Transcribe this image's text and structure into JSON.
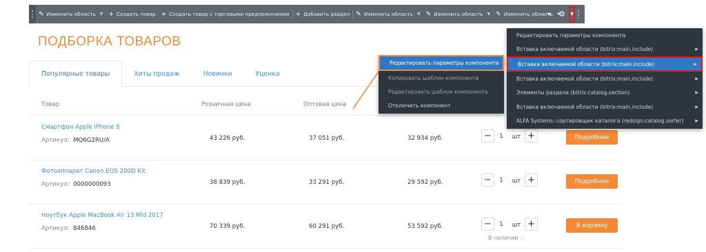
{
  "toolbar": {
    "items": [
      {
        "label": "Изменить область",
        "icon": "pencil-icon"
      },
      {
        "label": "Создать товар",
        "icon": "plus-icon"
      },
      {
        "label": "Создать товар с торговыми предложениями",
        "icon": "plus-icon"
      },
      {
        "label": "Добавить раздел",
        "icon": "plus-icon"
      },
      {
        "label": "Изменить область",
        "icon": "pencil-icon"
      },
      {
        "label": "Изменить область",
        "icon": "pencil-icon"
      },
      {
        "label": "Изменить область",
        "icon": "pencil-icon"
      }
    ]
  },
  "page": {
    "title": "ПОДБОРКА ТОВАРОВ"
  },
  "tabs": [
    "Популярные товары",
    "Хиты продаж",
    "Новинки",
    "Уценка"
  ],
  "table": {
    "headers": {
      "product": "Товар",
      "retail": "Розничная цена",
      "wholesale": "Оптовая цена"
    },
    "article_label": "Артикул:",
    "unit": "шт",
    "rows": [
      {
        "name": "Смартфон Apple iPhone 8",
        "article": "MQ6G2RU/A",
        "retail": "43 226 руб.",
        "wholesale": "37 051 руб.",
        "price3": "32 934 руб.",
        "qty": "1",
        "button": "Подробнее",
        "avail": ""
      },
      {
        "name": "Фотоаппарат Canon EOS 200D Kit",
        "article": "0000000093",
        "retail": "38 839 руб.",
        "wholesale": "33 291 руб.",
        "price3": "29 592 руб.",
        "qty": "1",
        "button": "Подробнее",
        "avail": ""
      },
      {
        "name": "Ноутбук Apple MacBook Air 13 Mid 2017",
        "article": "846846",
        "retail": "70 339 руб.",
        "wholesale": "60 291 руб.",
        "price3": "53 592 руб.",
        "qty": "1",
        "button": "В корзину",
        "avail": "В наличии"
      }
    ]
  },
  "menu_component": {
    "items": [
      "Редактировать параметры компонента",
      "Копировать шаблон компонента",
      "Редактировать шаблон компонента",
      "Отключить компонент"
    ]
  },
  "menu_areas": {
    "items": [
      "Редактировать параметры компонента",
      "Вставка включаемой области (bitrix:main.include)",
      "Вставка включаемой области (bitrix:main.include)",
      "Вставка включаемой области (bitrix:main.include)",
      "Элементы раздела (bitrix:catalog.section)",
      "Вставка включаемой области (bitrix:main.include)",
      "ALFA Systems: сортировщик каталога (redsign:catalog.sorter)"
    ]
  },
  "colors": {
    "accent": "#f08d3c",
    "link": "#3d8ed1",
    "toolbar": "#5f6771",
    "highlight": "#2f78c4",
    "marker": "#d91c1c"
  }
}
